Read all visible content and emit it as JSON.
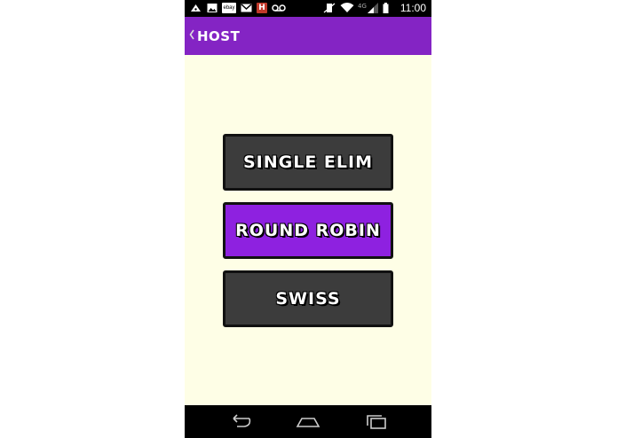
{
  "status_bar": {
    "left_icons": [
      "android-debug-icon",
      "image-icon",
      "ebay-icon",
      "gmail-icon",
      "app-h-icon",
      "voicemail-icon"
    ],
    "ebay_text": "ebay",
    "h_text": "H",
    "network": "4G",
    "time": "11:00"
  },
  "action_bar": {
    "title": "HOST",
    "color": "#8424c4"
  },
  "buttons": [
    {
      "label": "SINGLE ELIM",
      "color": "#3c3c3c"
    },
    {
      "label": "ROUND ROBIN",
      "color": "#8e21e0"
    },
    {
      "label": "SWISS",
      "color": "#3c3c3c"
    }
  ],
  "colors": {
    "background": "#fefee6",
    "accent": "#8424c4",
    "selected": "#8e21e0",
    "button": "#3c3c3c"
  }
}
